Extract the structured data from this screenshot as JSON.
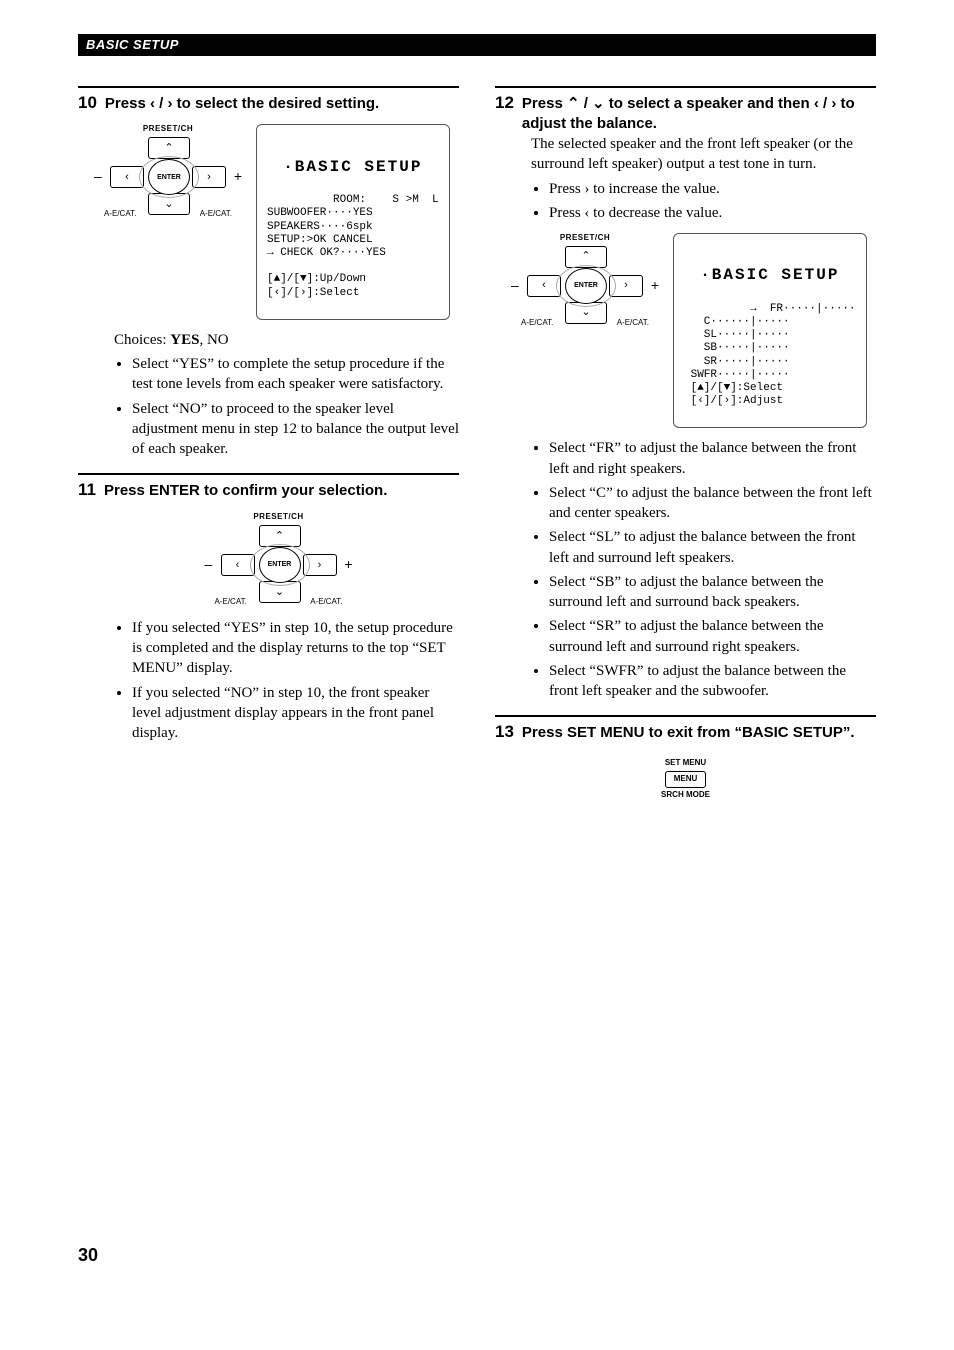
{
  "header": "BASIC SETUP",
  "pageNumber": "30",
  "dpad": {
    "top": "PRESET/CH",
    "center": "ENTER",
    "bottomLeft": "A-E/CAT.",
    "bottomRight": "A-E/CAT.",
    "minus": "–",
    "plus": "+",
    "leftArrow": "‹",
    "rightArrow": "›",
    "upArrow": "⌃",
    "downArrow": "⌄"
  },
  "step10": {
    "num": "10",
    "titleA": "Press ",
    "titleArrows": "‹ / ›",
    "titleB": " to select the desired setting.",
    "lcdTitle": "·BASIC SETUP",
    "lcdBody": "ROOM:    S >M  L\nSUBWOOFER····YES\nSPEAKERS····6spk\nSETUP:>OK CANCEL\n→ CHECK OK?····YES\n\n[▲]/[▼]:Up/Down\n[‹]/[›]:Select",
    "choicesLabel": "Choices: ",
    "choicesBold": "YES",
    "choicesRest": ", NO",
    "bullet1": "Select “YES” to complete the setup procedure if the test tone levels from each speaker were satisfactory.",
    "bullet2": "Select “NO” to proceed to the speaker level adjustment menu in step 12 to balance the output level of each speaker."
  },
  "step11": {
    "num": "11",
    "title": "Press ENTER to confirm your selection.",
    "bullet1": "If you selected “YES” in step 10, the setup procedure is completed and the display returns to the top “SET MENU” display.",
    "bullet2": "If you selected “NO” in step 10, the front speaker level adjustment display appears in the front panel display."
  },
  "step12": {
    "num": "12",
    "titleA": "Press ",
    "titleArrows1": "⌃ / ⌄",
    "titleB": " to select a speaker and then ",
    "titleArrows2": "‹ / ›",
    "titleC": " to adjust the balance.",
    "intro": "The selected speaker and the front left speaker (or the surround left speaker) output a test tone in turn.",
    "introB1": "Press › to increase the value.",
    "introB2": "Press ‹ to decrease the value.",
    "lcdTitle": "·BASIC SETUP",
    "lcdBody": "→  FR·····|·····\n   C······|·····\n   SL·····|·····\n   SB·····|·····\n   SR·····|·····\n SWFR·····|·····\n [▲]/[▼]:Select\n [‹]/[›]:Adjust",
    "b1": "Select “FR” to adjust the balance between the front left and right speakers.",
    "b2": "Select “C” to adjust the balance between the front left and center speakers.",
    "b3": "Select “SL” to adjust the balance between the front left and surround left speakers.",
    "b4": "Select “SB” to adjust the balance between the surround left and surround back speakers.",
    "b5": "Select “SR” to adjust the balance between the surround left and surround right speakers.",
    "b6": "Select “SWFR” to adjust the balance between the front left speaker and the subwoofer."
  },
  "step13": {
    "num": "13",
    "title": "Press SET MENU to exit from “BASIC SETUP”.",
    "btnTop": "SET MENU",
    "btnMid": "MENU",
    "btnBot": "SRCH MODE"
  }
}
